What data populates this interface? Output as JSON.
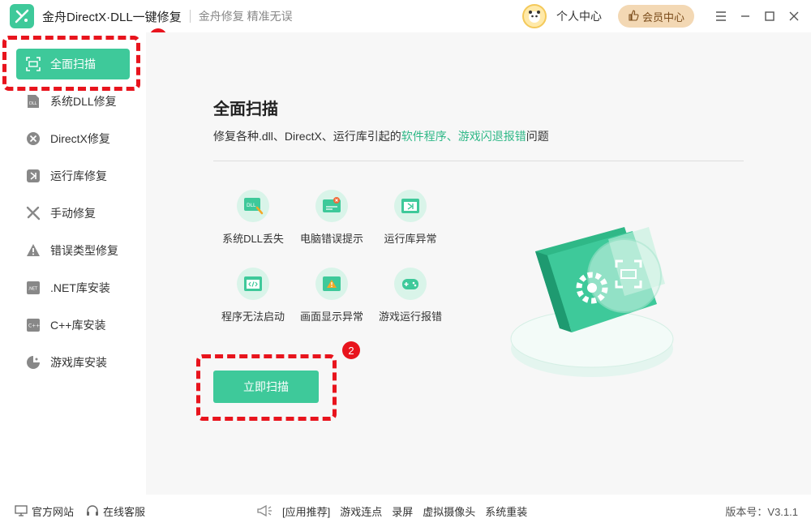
{
  "app": {
    "title": "金舟DirectX·DLL一键修复",
    "slogan": "金舟修复 精准无误"
  },
  "header": {
    "user_center": "个人中心",
    "vip_center": "会员中心"
  },
  "sidebar": {
    "items": [
      {
        "label": "全面扫描",
        "icon": "scan-icon",
        "active": true
      },
      {
        "label": "系统DLL修复",
        "icon": "dll-icon"
      },
      {
        "label": "DirectX修复",
        "icon": "directx-icon"
      },
      {
        "label": "运行库修复",
        "icon": "runtime-icon"
      },
      {
        "label": "手动修复",
        "icon": "wrench-icon"
      },
      {
        "label": "错误类型修复",
        "icon": "warning-icon"
      },
      {
        "label": ".NET库安装",
        "icon": "dotnet-icon"
      },
      {
        "label": "C++库安装",
        "icon": "cpp-icon"
      },
      {
        "label": "游戏库安装",
        "icon": "game-icon"
      }
    ]
  },
  "main": {
    "title": "全面扫描",
    "desc_prefix": "修复各种.dll、DirectX、运行库引起的",
    "desc_highlight": "软件程序、游戏闪退报错",
    "desc_suffix": "问题",
    "features": [
      {
        "label": "系统DLL丢失",
        "icon": "dll-file-icon"
      },
      {
        "label": "电脑错误提示",
        "icon": "error-window-icon"
      },
      {
        "label": "运行库异常",
        "icon": "runtime-window-icon"
      },
      {
        "label": "程序无法启动",
        "icon": "code-window-icon"
      },
      {
        "label": "画面显示异常",
        "icon": "display-warning-icon"
      },
      {
        "label": "游戏运行报错",
        "icon": "gamepad-icon"
      }
    ],
    "scan_button": "立即扫描"
  },
  "annotations": {
    "badge1": "1",
    "badge2": "2"
  },
  "footer": {
    "official_site": "官方网站",
    "online_service": "在线客服",
    "promo_label": "[应用推荐]",
    "promo_links": [
      "游戏连点",
      "录屏",
      "虚拟摄像头",
      "系统重装"
    ],
    "version": "版本号：V3.1.1"
  },
  "colors": {
    "accent": "#3ec99a",
    "highlight": "#2fb887",
    "annotation": "#e8141d"
  }
}
